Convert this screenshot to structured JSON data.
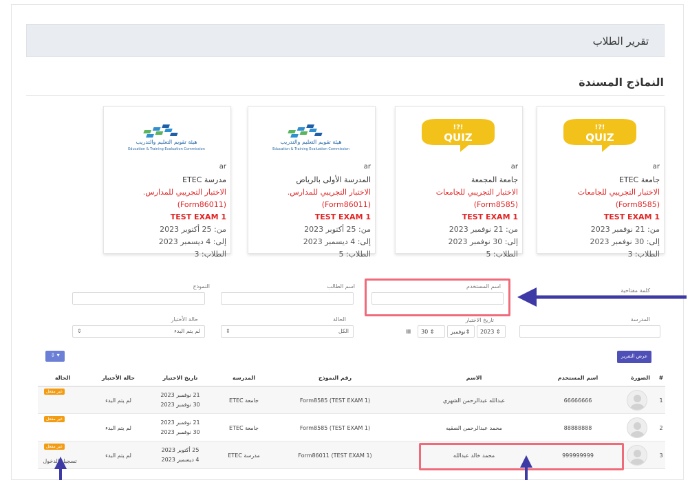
{
  "header": {
    "title": "تقرير الطلاب"
  },
  "assigned": {
    "title": "النماذج المسندة"
  },
  "cards": [
    {
      "thumb": "quiz",
      "lang": "ar",
      "school": "جامعة ETEC",
      "exam": "الاختبار التجريبي للجامعات",
      "code": "(Form8585)",
      "test": "TEST EXAM 1",
      "from": "من: 21 نوفمبر 2023",
      "to": "إلى: 30 نوفمبر 2023",
      "students": "الطلاب: 3"
    },
    {
      "thumb": "quiz",
      "lang": "ar",
      "school": "جامعة المجمعة",
      "exam": "الاختبار التجريبي للجامعات",
      "code": "(Form8585)",
      "test": "TEST EXAM 1",
      "from": "من: 21 نوفمبر 2023",
      "to": "إلى: 30 نوفمبر 2023",
      "students": "الطلاب: 5"
    },
    {
      "thumb": "etec",
      "lang": "ar",
      "school": "المدرسة الأولى بالرياض",
      "exam": "الاختبار التجريبي للمدارس.",
      "code": "(Form86011)",
      "test": "TEST EXAM 1",
      "from": "من: 25 أكتوبر 2023",
      "to": "إلى: 4 ديسمبر 2023",
      "students": "الطلاب: 5"
    },
    {
      "thumb": "etec",
      "lang": "ar",
      "school": "مدرسة ETEC",
      "exam": "الاختبار التجريبي للمدارس.",
      "code": "(Form86011)",
      "test": "TEST EXAM 1",
      "from": "من: 25 أكتوبر 2023",
      "to": "إلى: 4 ديسمبر 2023",
      "students": "الطلاب: 3"
    }
  ],
  "quiz_logo": {
    "top": "!?!",
    "word": "QUIZ",
    "color": "#f2c21b"
  },
  "etec_logo": {
    "ar": "هيئة تقويم التعليم والتدريب",
    "en": "Education & Training Evaluation Commission"
  },
  "filters": {
    "keyword_label": "كلمة مفتاحية",
    "username_label": "اسم المستخدم",
    "student_name_label": "اسم الطالب",
    "form_label": "النموذج",
    "school_label": "المدرسة",
    "exam_date_label": "تاريخ الاختبار",
    "year": "2023",
    "month": "نوفمبر",
    "day": "30",
    "status_label": "الحالة",
    "status_value": "الكل",
    "exam_status_label": "حالة الأختبار",
    "exam_status_value": "لم يتم البدء",
    "show_report": "عرض التقرير",
    "export": "⇩ ▾"
  },
  "table": {
    "headers": [
      "#",
      "الصورة",
      "اسم المستخدم",
      "الاسم",
      "رقم النموذج",
      "المدرسة",
      "تاريخ الاختبار",
      "حالة الأختبار",
      "الحالة"
    ],
    "rows": [
      {
        "n": "1",
        "username": "66666666",
        "name": "عبدالله عبدالرحمن الشهري",
        "form": "Form8585 (TEST EXAM 1)",
        "school": "جامعة ETEC",
        "date1": "21 نوفمبر 2023",
        "date2": "30 نوفمبر 2023",
        "exam_status": "لم يتم البدء",
        "badge": "غير مفعل",
        "status": ""
      },
      {
        "n": "2",
        "username": "88888888",
        "name": "محمد عبدالرحمن الصقيه",
        "form": "Form8585 (TEST EXAM 1)",
        "school": "جامعة ETEC",
        "date1": "21 نوفمبر 2023",
        "date2": "30 نوفمبر 2023",
        "exam_status": "لم يتم البدء",
        "badge": "غير مفعل",
        "status": ""
      },
      {
        "n": "3",
        "username": "999999999",
        "name": "محمد خالد عبدالله",
        "form": "Form86011 (TEST EXAM 1)",
        "school": "مدرسة ETEC",
        "date1": "25 أكتوبر 2023",
        "date2": "4 ديسمبر 2023",
        "exam_status": "لم يتم البدء",
        "badge": "غير مفعل",
        "status": "تسجيل الدخول"
      }
    ]
  },
  "annotations": {
    "arrow_color": "#3d3aa6",
    "highlight_color": "#f06b7a"
  }
}
